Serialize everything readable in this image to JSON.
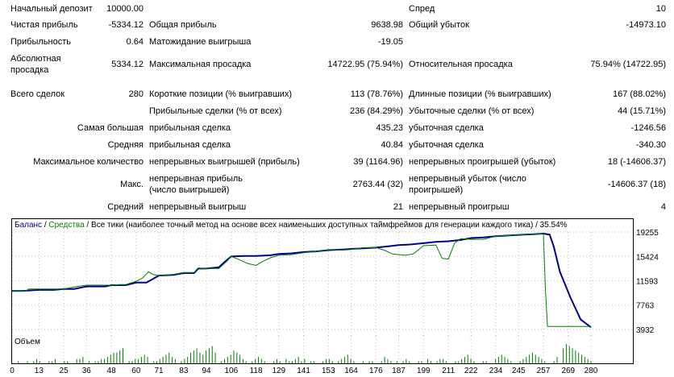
{
  "stats": {
    "initial_deposit_label": "Начальный депозит",
    "initial_deposit": "10000.00",
    "spread_label": "Спред",
    "spread": "10",
    "net_profit_label": "Чистая прибыль",
    "net_profit": "-5334.12",
    "gross_profit_label": "Общая прибыль",
    "gross_profit": "9638.98",
    "gross_loss_label": "Общий убыток",
    "gross_loss": "-14973.10",
    "profit_factor_label": "Прибыльность",
    "profit_factor": "0.64",
    "expected_payoff_label": "Матожидание выигрыша",
    "expected_payoff": "-19.05",
    "abs_drawdown_label": "Абсолютная просадка",
    "abs_drawdown": "5334.12",
    "max_drawdown_label": "Максимальная просадка",
    "max_drawdown": "14722.95 (75.94%)",
    "rel_drawdown_label": "Относительная просадка",
    "rel_drawdown": "75.94% (14722.95)",
    "total_trades_label": "Всего сделок",
    "total_trades": "280",
    "short_positions_label": "Короткие позиции (% выигравших)",
    "short_positions": "113 (78.76%)",
    "long_positions_label": "Длинные позиции (% выигравших)",
    "long_positions": "167 (88.02%)",
    "profit_trades_label": "Прибыльные сделки (% от всех)",
    "profit_trades": "236 (84.29%)",
    "loss_trades_label": "Убыточные сделки (% от всех)",
    "loss_trades": "44 (15.71%)",
    "largest_label": "Самая большая",
    "largest_profit_label": "прибыльная сделка",
    "largest_profit": "435.23",
    "largest_loss_label": "убыточная сделка",
    "largest_loss": "-1246.56",
    "average_label": "Средняя",
    "average_profit_label": "прибыльная сделка",
    "average_profit": "40.84",
    "average_loss_label": "убыточная сделка",
    "average_loss": "-340.30",
    "max_count_label": "Максимальное количество",
    "max_consec_wins_label": "непрерывных выигрышей (прибыль)",
    "max_consec_wins": "39 (1164.96)",
    "max_consec_losses_label": "непрерывных проигрышей (убыток)",
    "max_consec_losses": "18 (-14606.37)",
    "max_label": "Макс.",
    "max_consec_profit_label": "непрерывная прибыль (число выигрышей)",
    "max_consec_profit": "2763.44 (32)",
    "max_consec_loss_label": "непрерывный убыток (число проигрышей)",
    "max_consec_loss": "-14606.37 (18)",
    "avg_label": "Средний",
    "avg_consec_wins_label": "непрерывный выигрыш",
    "avg_consec_wins": "21",
    "avg_consec_losses_label": "непрерывный проигрыш",
    "avg_consec_losses": "4"
  },
  "chart": {
    "legend_balance": "Баланс",
    "legend_sep": " / ",
    "legend_equity": "Средства",
    "legend_rest": " / Все тики (наиболее точный метод на основе всех наименьших доступных таймфреймов для генерации каждого тика) / 35.54%",
    "volume_label": "Объем",
    "balance_color": "#00008b",
    "equity_color": "#008000"
  },
  "chart_data": {
    "type": "line",
    "y_ticks": [
      "19255",
      "15424",
      "11593",
      "7763",
      "3932"
    ],
    "x_ticks": [
      "0",
      "13",
      "25",
      "36",
      "48",
      "60",
      "71",
      "83",
      "94",
      "106",
      "118",
      "129",
      "141",
      "153",
      "164",
      "176",
      "187",
      "199",
      "211",
      "222",
      "234",
      "245",
      "257",
      "269",
      "280"
    ],
    "ylim": [
      3932,
      19255
    ],
    "xlim": [
      0,
      280
    ],
    "series": [
      {
        "name": "Баланс",
        "x": [
          0,
          5,
          13,
          20,
          25,
          30,
          36,
          45,
          48,
          55,
          60,
          65,
          71,
          78,
          83,
          88,
          90,
          94,
          100,
          103,
          106,
          112,
          118,
          125,
          129,
          135,
          141,
          147,
          153,
          160,
          164,
          170,
          176,
          182,
          187,
          193,
          199,
          205,
          211,
          217,
          222,
          228,
          234,
          240,
          245,
          252,
          257,
          260,
          262,
          265,
          270,
          275,
          280
        ],
        "y": [
          10000,
          10000,
          10150,
          10150,
          10300,
          10300,
          10700,
          10700,
          10900,
          10900,
          11300,
          11300,
          12400,
          12500,
          12800,
          12800,
          13500,
          13500,
          13700,
          14600,
          15400,
          15500,
          15500,
          15600,
          15800,
          15900,
          16100,
          16200,
          16400,
          16500,
          16600,
          16700,
          16800,
          17000,
          17200,
          17300,
          17500,
          17700,
          17800,
          18000,
          18300,
          18400,
          18600,
          18700,
          18800,
          18900,
          19000,
          18850,
          17000,
          13000,
          9000,
          5500,
          4280
        ]
      },
      {
        "name": "Средства",
        "x": [
          0,
          7,
          8,
          13,
          20,
          25,
          30,
          36,
          48,
          52,
          55,
          60,
          63,
          66,
          68,
          71,
          78,
          83,
          88,
          90,
          94,
          100,
          104,
          106,
          110,
          114,
          118,
          121,
          125,
          129,
          135,
          141,
          147,
          153,
          160,
          164,
          170,
          176,
          180,
          184,
          190,
          194,
          199,
          205,
          208,
          211,
          214,
          217,
          222,
          228,
          234,
          240,
          245,
          252,
          257,
          258,
          259,
          280
        ],
        "y": [
          10000,
          10000,
          10300,
          10300,
          10300,
          10300,
          10600,
          10900,
          10900,
          11000,
          11000,
          11500,
          12000,
          13000,
          12600,
          12400,
          12600,
          12900,
          12900,
          13600,
          13500,
          13500,
          14700,
          15400,
          14900,
          14300,
          14000,
          14600,
          15200,
          15600,
          15700,
          16000,
          16200,
          16500,
          16400,
          16500,
          16800,
          16800,
          16400,
          15800,
          15600,
          15800,
          17100,
          17200,
          15100,
          15000,
          17500,
          18200,
          18100,
          18100,
          18600,
          18700,
          18800,
          18900,
          19000,
          10000,
          4400,
          4400
        ]
      }
    ],
    "volume": [
      0,
      0,
      1,
      0,
      0,
      1,
      0,
      1,
      2,
      1,
      0,
      0,
      1,
      1,
      2,
      0,
      0,
      1,
      1,
      0,
      0,
      2,
      2,
      3,
      0,
      1,
      0,
      1,
      1,
      2,
      2,
      3,
      4,
      5,
      5,
      6,
      7,
      0,
      1,
      1,
      2,
      2,
      3,
      4,
      3,
      0,
      1,
      1,
      2,
      3,
      4,
      5,
      3,
      2,
      0,
      1,
      2,
      3,
      5,
      6,
      7,
      5,
      4,
      6,
      7,
      8,
      5,
      0,
      1,
      2,
      3,
      4,
      6,
      5,
      4,
      2,
      1,
      0,
      1,
      2,
      3,
      2,
      1,
      0,
      0,
      1,
      2,
      1,
      0,
      2,
      1,
      1,
      2,
      3,
      1,
      2,
      0,
      1,
      1,
      0,
      0,
      1,
      2,
      2,
      1,
      0,
      1,
      2,
      3,
      4,
      2,
      1,
      0,
      0,
      1,
      0,
      1,
      1,
      0,
      0,
      1,
      3,
      2,
      1,
      0,
      1,
      0,
      1,
      2,
      1,
      0,
      0,
      1,
      1,
      0,
      2,
      1,
      0,
      1,
      2,
      2,
      1,
      0,
      0,
      1,
      1,
      2,
      3,
      4,
      2,
      1,
      0,
      0,
      1,
      1,
      0,
      0,
      2,
      3,
      4,
      3,
      2,
      1,
      0,
      0,
      1,
      2,
      3,
      4,
      5,
      4,
      3,
      2,
      1,
      0,
      0,
      1,
      3,
      0,
      7,
      9,
      8,
      7,
      6,
      5,
      4,
      3,
      2,
      1
    ]
  }
}
